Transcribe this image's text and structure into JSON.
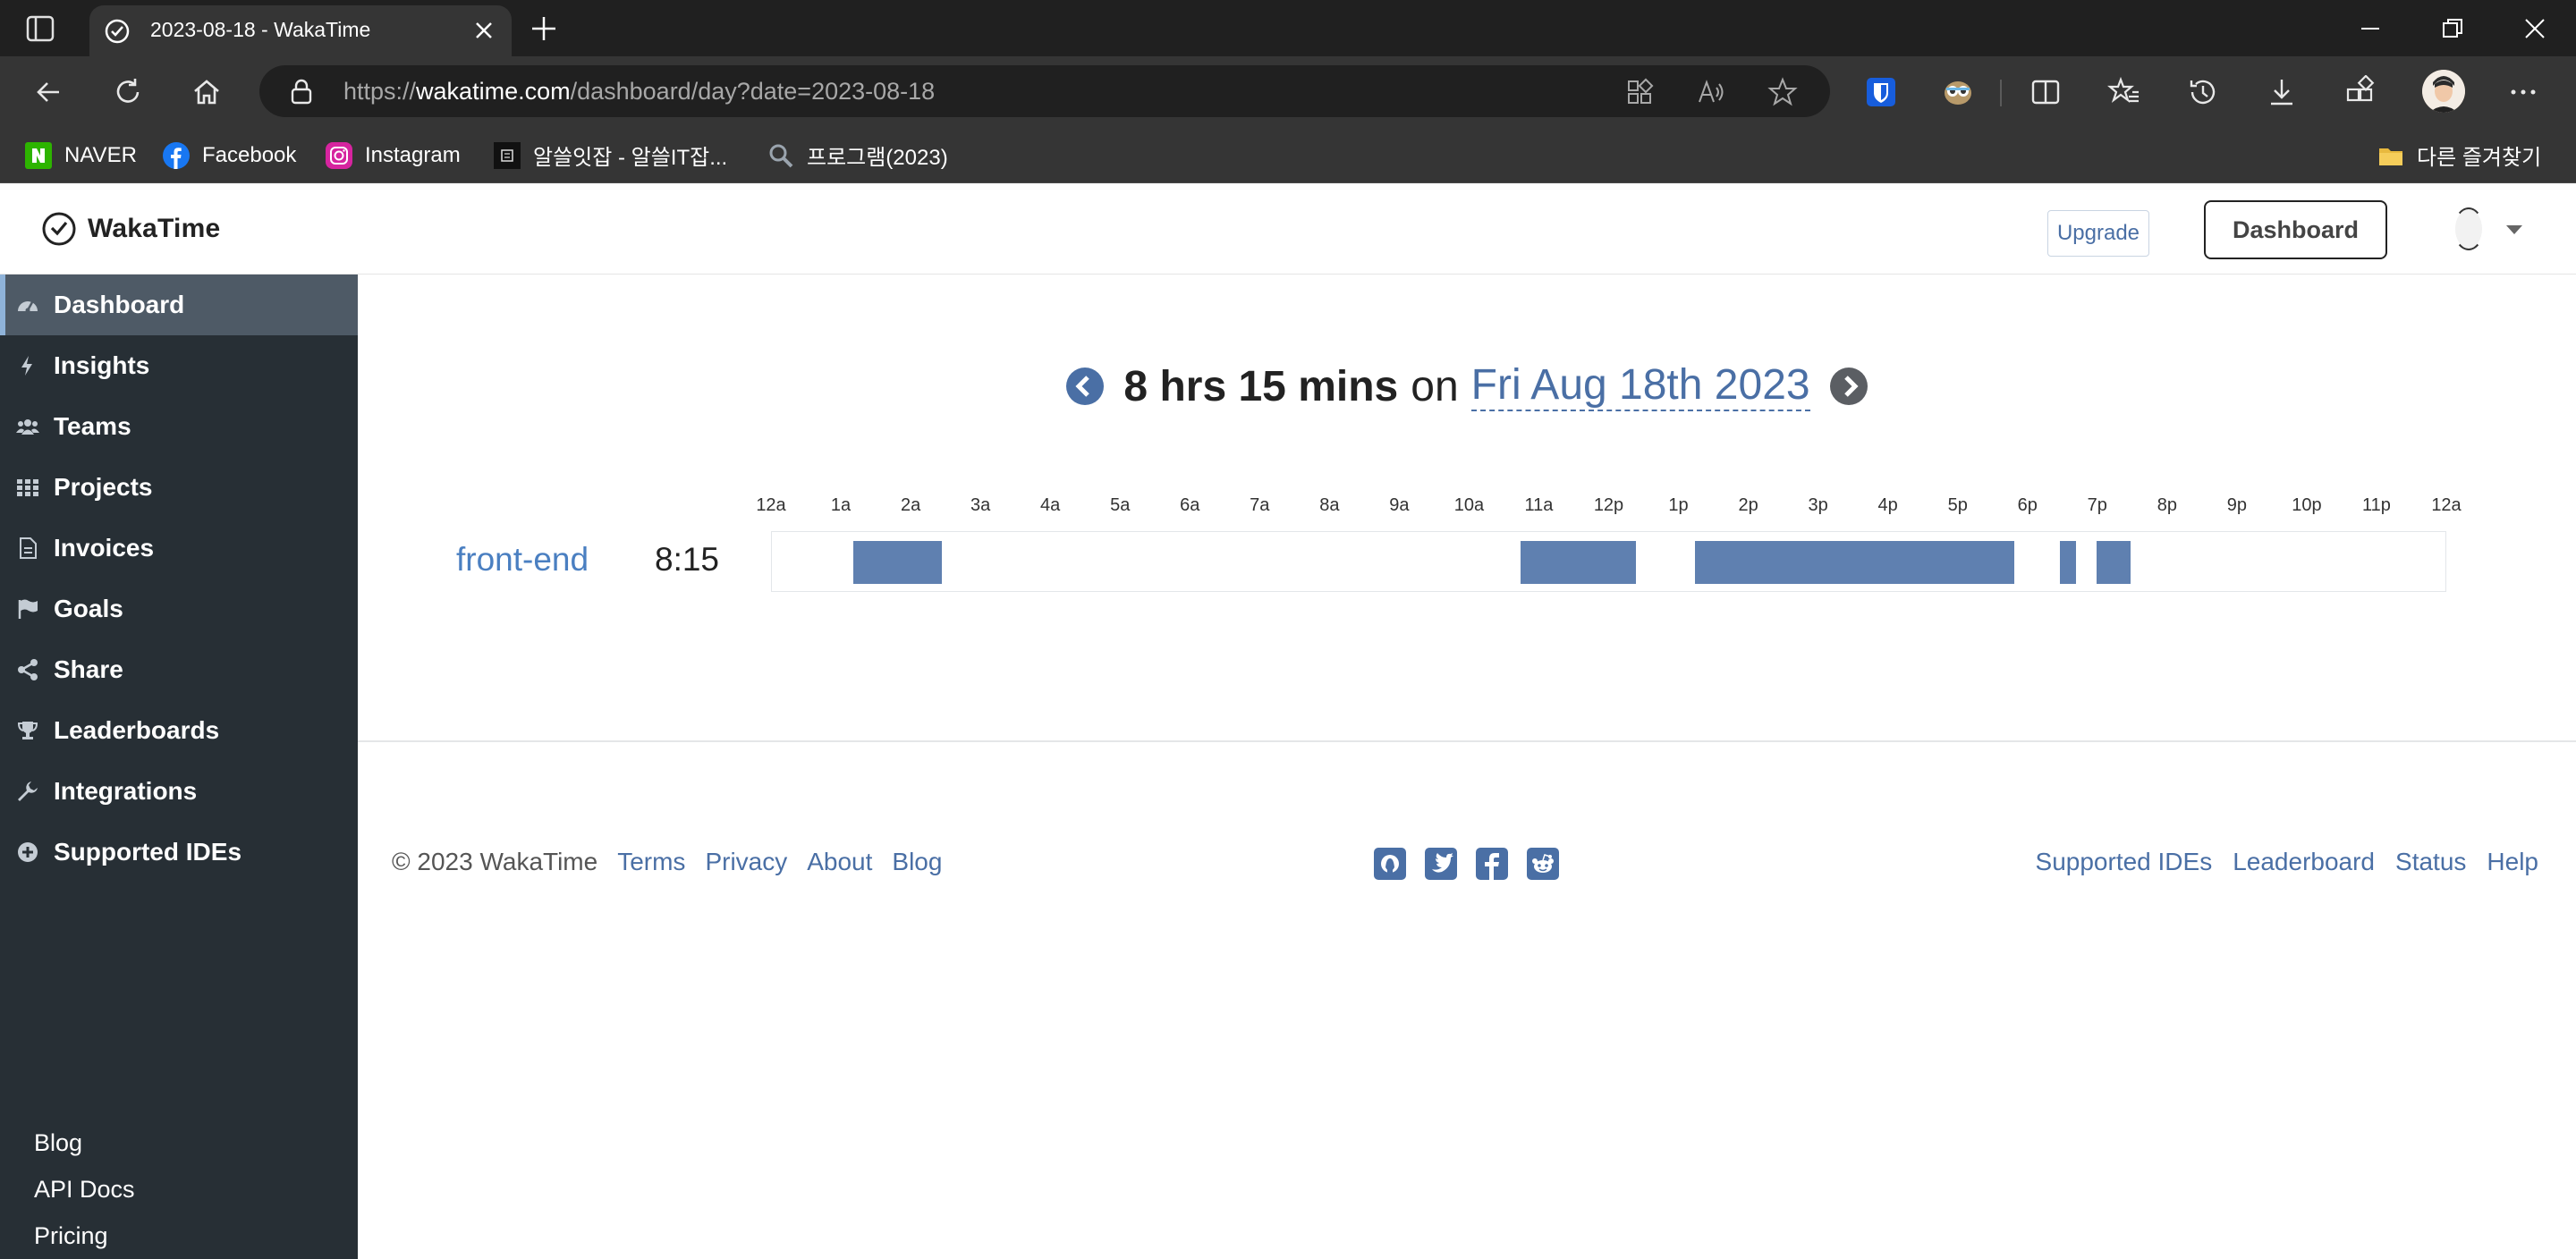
{
  "browser": {
    "tab": {
      "title": "2023-08-18 - WakaTime"
    },
    "address": {
      "scheme": "https://",
      "host": "wakatime.com",
      "path": "/dashboard/day?date=2023-08-18"
    },
    "bookmarks": [
      {
        "label": "NAVER",
        "icon": "naver-icon",
        "color": "#2db400"
      },
      {
        "label": "Facebook",
        "icon": "facebook-icon",
        "color": "#1877f2"
      },
      {
        "label": "Instagram",
        "icon": "instagram-icon",
        "color": "#d6249f"
      },
      {
        "label": "알쓸잇잡 - 알쓸IT잡...",
        "icon": "site-icon",
        "color": "#111111"
      },
      {
        "label": "프로그램(2023)",
        "icon": "search-icon",
        "color": "#9aa4ae"
      }
    ],
    "other_bookmarks": "다른 즐겨찾기"
  },
  "app": {
    "logo": "WakaTime",
    "upgrade_label": "Upgrade",
    "dashboard_label": "Dashboard"
  },
  "sidebar": {
    "items": [
      {
        "label": "Dashboard",
        "icon": "dashboard-icon",
        "active": true
      },
      {
        "label": "Insights",
        "icon": "bolt-icon"
      },
      {
        "label": "Teams",
        "icon": "users-icon"
      },
      {
        "label": "Projects",
        "icon": "grid-icon"
      },
      {
        "label": "Invoices",
        "icon": "file-icon"
      },
      {
        "label": "Goals",
        "icon": "flag-icon"
      },
      {
        "label": "Share",
        "icon": "share-icon"
      },
      {
        "label": "Leaderboards",
        "icon": "trophy-icon"
      },
      {
        "label": "Integrations",
        "icon": "wrench-icon"
      },
      {
        "label": "Supported IDEs",
        "icon": "plus-circle-icon"
      }
    ],
    "bottom_links": [
      "Blog",
      "API Docs",
      "Pricing"
    ]
  },
  "day": {
    "total": "8 hrs 15 mins",
    "on": "on",
    "date": "Fri Aug 18th 2023",
    "project": {
      "name": "front-end",
      "time": "8:15"
    },
    "hour_labels": [
      "12a",
      "1a",
      "2a",
      "3a",
      "4a",
      "5a",
      "6a",
      "7a",
      "8a",
      "9a",
      "10a",
      "11a",
      "12p",
      "1p",
      "2p",
      "3p",
      "4p",
      "5p",
      "6p",
      "7p",
      "8p",
      "9p",
      "10p",
      "11p",
      "12a"
    ],
    "segments_hours": [
      {
        "start": 1.17,
        "end": 2.43
      },
      {
        "start": 10.72,
        "end": 12.38
      },
      {
        "start": 13.22,
        "end": 17.8
      },
      {
        "start": 18.45,
        "end": 18.68
      },
      {
        "start": 18.98,
        "end": 19.47
      }
    ],
    "bar_color": "#5f80b0"
  },
  "footer": {
    "copyright": "© 2023 WakaTime",
    "left_links": [
      "Terms",
      "Privacy",
      "About",
      "Blog"
    ],
    "social": [
      "github-icon",
      "twitter-icon",
      "facebook-icon",
      "reddit-icon"
    ],
    "right_links": [
      "Supported IDEs",
      "Leaderboard",
      "Status",
      "Help"
    ]
  }
}
